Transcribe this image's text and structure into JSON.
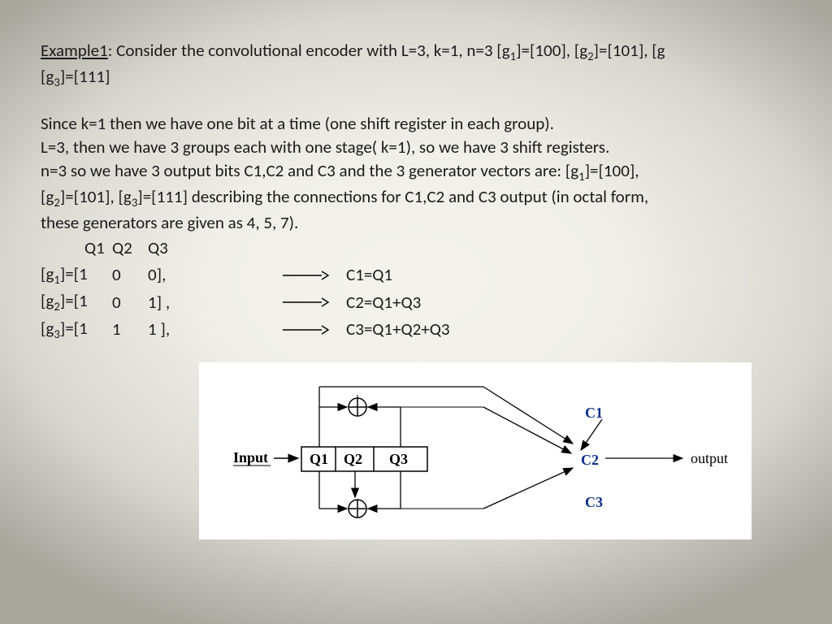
{
  "title_label": "Example1",
  "title_rest": ": Consider the convolutional encoder with L=3, k=1, n=3 [g",
  "title_g1": "]=[100], [g",
  "title_g2": "]=[101], [g",
  "title_g3": "]=[111]",
  "p2_l1": "Since k=1 then we have one bit at a time (one shift register in each group).",
  "p2_l2": "L=3, then we have 3 groups each with one stage( k=1), so we have 3 shift registers.",
  "p2_l3a": "n=3 so we have 3 output bits C1,C2 and C3 and the 3 generator vectors are: [g",
  "p2_l3b": "]=[100],",
  "p2_l4a": "[g",
  "p2_l4b": "]=[101], [g",
  "p2_l4c": "]=[111] describing the connections for C1,C2 and C3 output (in octal form,",
  "p2_l5": "these generators are given as 4, 5, 7).",
  "hdr_q1": "Q1",
  "hdr_q2": "Q2",
  "hdr_q3": "Q3",
  "rows": [
    {
      "pre": "[g",
      "sub": "1",
      "v1": "]=[1",
      "v2": "0",
      "v3": "0],",
      "eq": "C1=Q1"
    },
    {
      "pre": "[g",
      "sub": "2",
      "v1": "]=[1",
      "v2": "0",
      "v3": "1] ,",
      "eq": "C2=Q1+Q3"
    },
    {
      "pre": "[g",
      "sub": "3",
      "v1": "]=[1",
      "v2": "1",
      "v3": "1 ],",
      "eq": " C3=Q1+Q2+Q3"
    }
  ],
  "diagram": {
    "input": "Input",
    "q1": "Q1",
    "q2": "Q2",
    "q3": "Q3",
    "c1": "C1",
    "c2": "C2",
    "c3": "C3",
    "output": "output"
  }
}
